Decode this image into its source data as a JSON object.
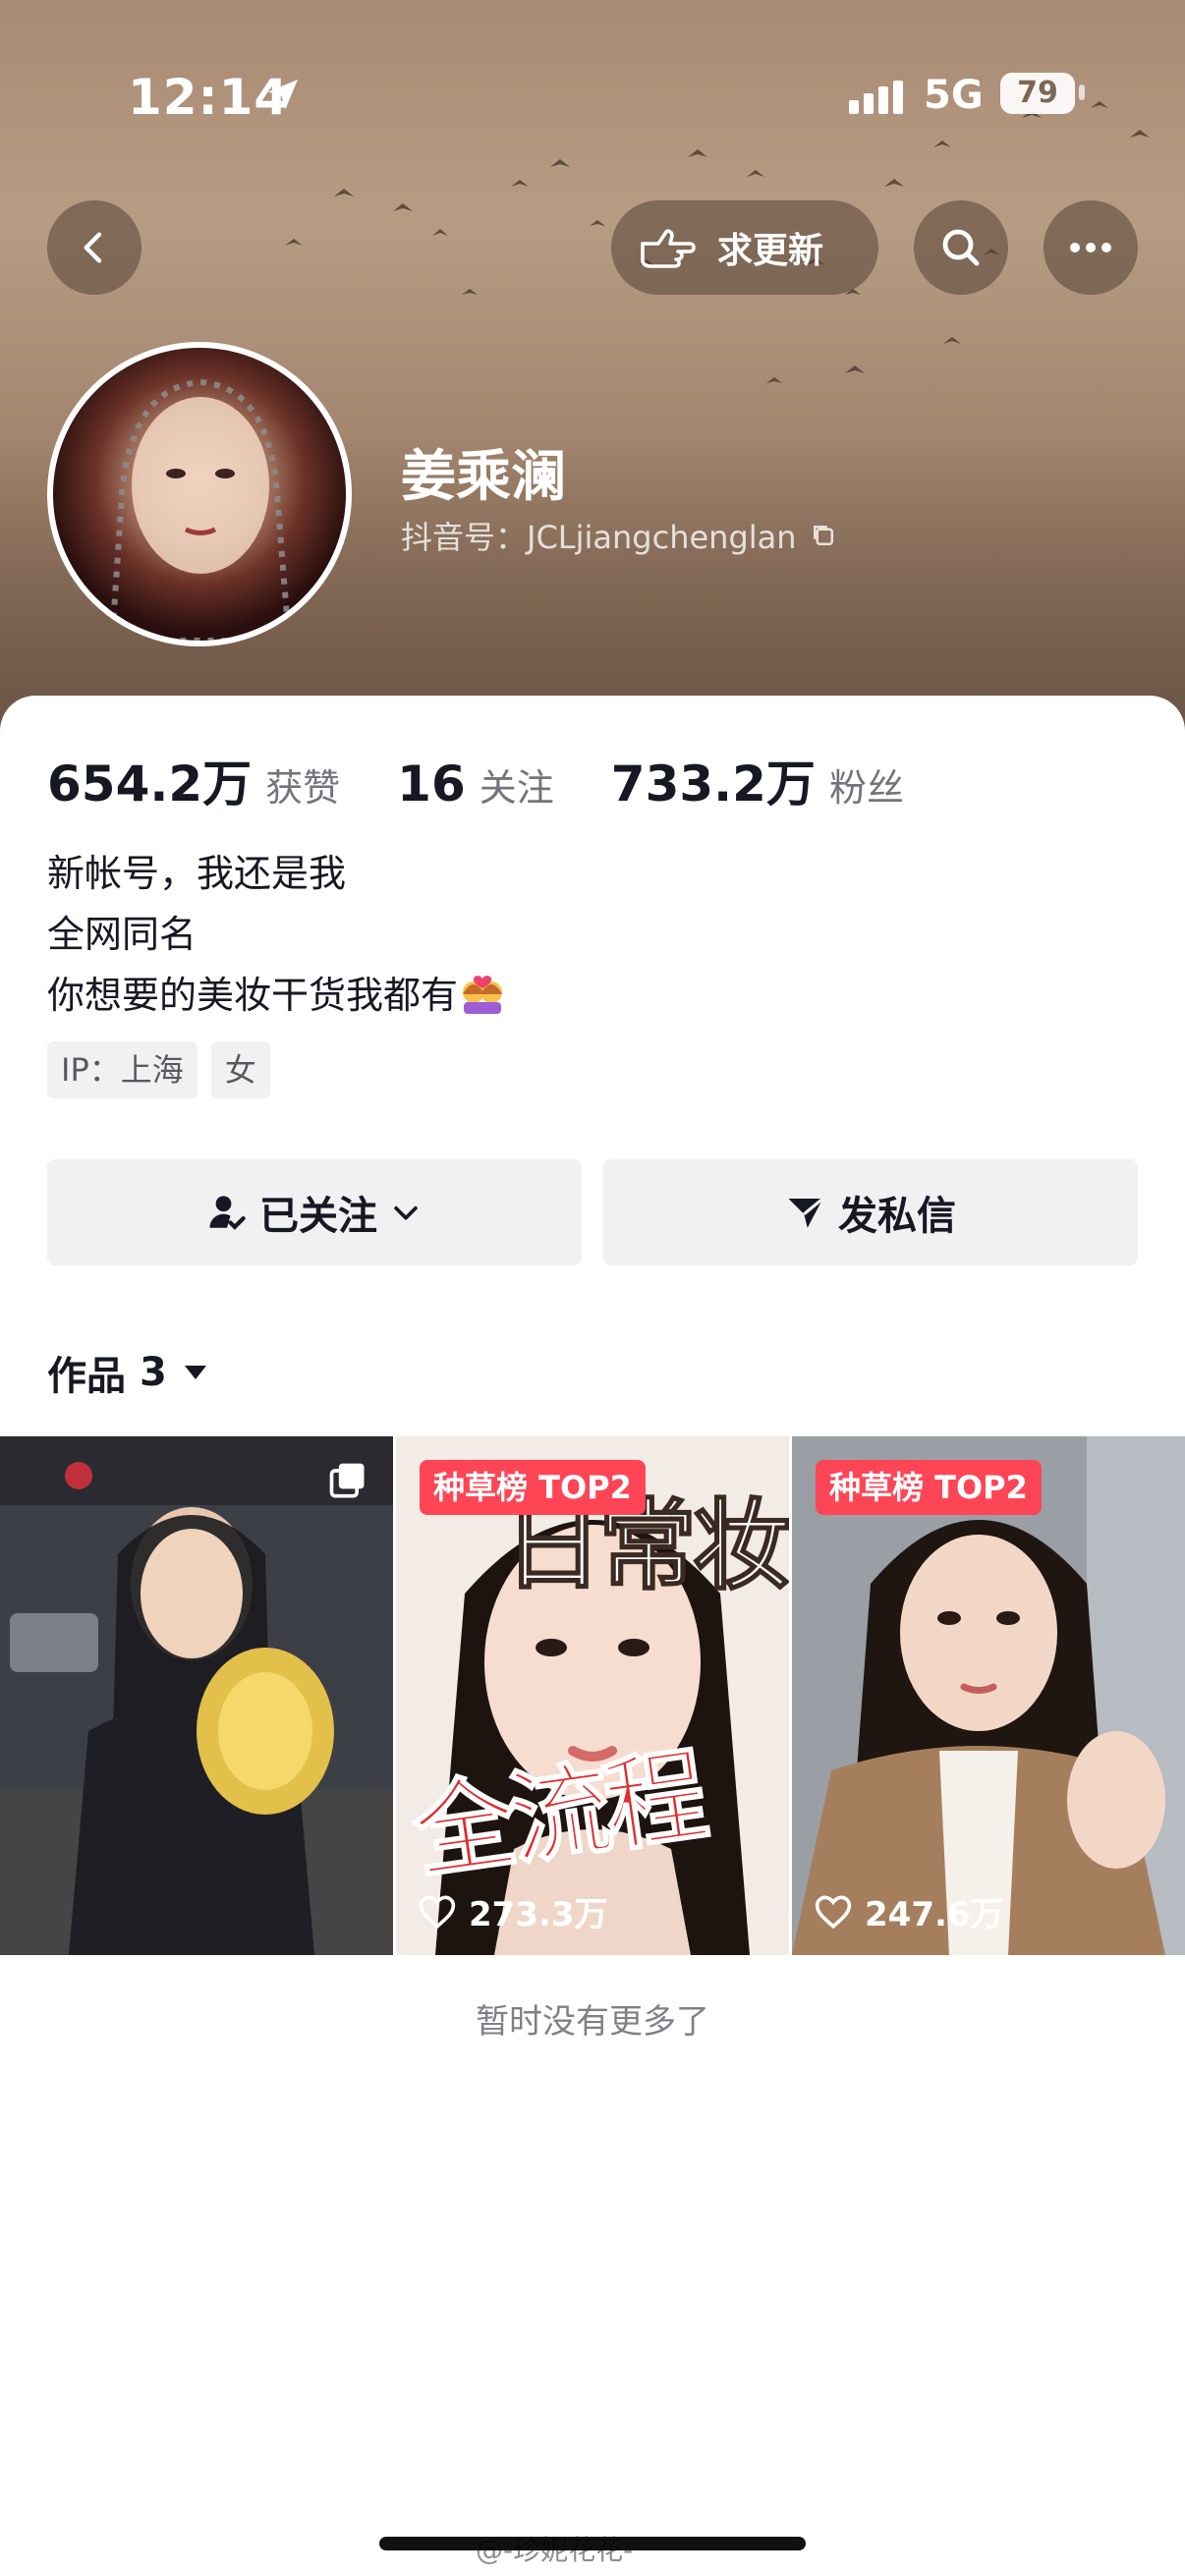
{
  "status_bar": {
    "time": "12:14",
    "network": "5G",
    "battery": "79"
  },
  "header": {
    "update_button_label": "求更新"
  },
  "profile": {
    "name": "姜乘澜",
    "douyin_id": "抖音号：JCLjiangchenglan",
    "stats": [
      {
        "value": "654.2万",
        "label": "获赞"
      },
      {
        "value": "16",
        "label": "关注"
      },
      {
        "value": "733.2万",
        "label": "粉丝"
      }
    ],
    "bio": [
      "新帐号，我还是我",
      "全网同名",
      "你想要的美妆干货我都有"
    ],
    "tags": [
      "IP：上海",
      "女"
    ]
  },
  "actions": {
    "follow_label": "已关注",
    "message_label": "发私信"
  },
  "works": {
    "title": "作品",
    "count": "3",
    "items": [
      {
        "badge": "",
        "likes": "",
        "multi_image": true
      },
      {
        "badge": "种草榜 TOP2",
        "likes": "273.3万",
        "overlay_top": "日常妆",
        "overlay_bottom": "全流程"
      },
      {
        "badge": "种草榜 TOP2",
        "likes": "247.6万"
      }
    ],
    "end_text": "暂时没有更多了"
  },
  "watermark": "@-珍妮花花-",
  "colors": {
    "badge_red": "#fe4556",
    "text_primary": "#161823",
    "button_bg": "#f1f1f2"
  }
}
